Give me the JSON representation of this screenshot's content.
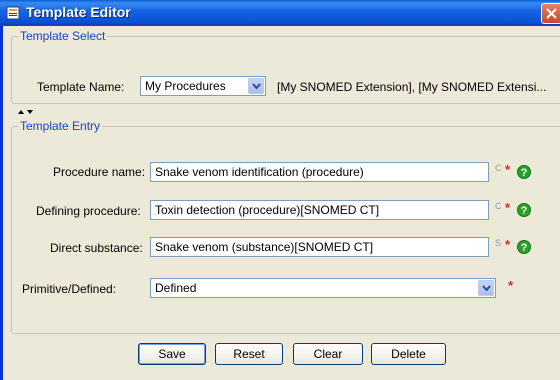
{
  "window": {
    "title": "Template Editor"
  },
  "template_select": {
    "group_title": "Template Select",
    "name_label": "Template Name:",
    "selected": "My Procedures",
    "extensions_text": "[My SNOMED Extension], [My SNOMED Extensi..."
  },
  "template_entry": {
    "group_title": "Template Entry",
    "rows": [
      {
        "label": "Procedure name:",
        "value": "Snake venom identification (procedure)",
        "type_letter": "C",
        "required": "*",
        "help": "?"
      },
      {
        "label": "Defining procedure:",
        "value": "Toxin detection (procedure)[SNOMED CT]",
        "type_letter": "C",
        "required": "*",
        "help": "?"
      },
      {
        "label": "Direct substance:",
        "value": "Snake venom (substance)[SNOMED CT]",
        "type_letter": "S",
        "required": "*",
        "help": "?"
      }
    ],
    "primitive": {
      "label": "Primitive/Defined:",
      "selected": "Defined",
      "required": "*"
    }
  },
  "buttons": {
    "save": "Save",
    "reset": "Reset",
    "clear": "Clear",
    "delete": "Delete"
  },
  "colors": {
    "titlebar": "#0b50d2",
    "group_title": "#1546c6",
    "required": "#e8201f",
    "help": "#2aa02a"
  }
}
